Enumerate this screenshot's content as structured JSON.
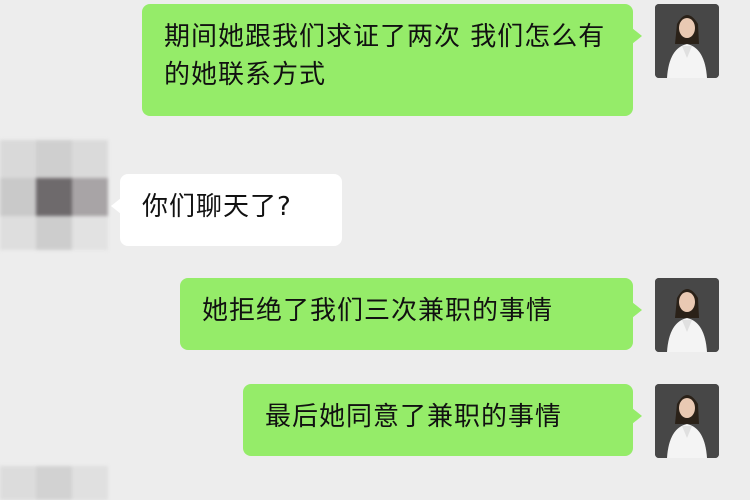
{
  "messages": [
    {
      "side": "sent",
      "text": "期间她跟我们求证了两次 我们怎么有的她联系方式"
    },
    {
      "side": "received",
      "text": "你们聊天了?"
    },
    {
      "side": "sent",
      "text": "她拒绝了我们三次兼职的事情"
    },
    {
      "side": "sent",
      "text": "最后她同意了兼职的事情"
    }
  ],
  "colors": {
    "background": "#ededed",
    "sent_bubble": "#95ec69",
    "received_bubble": "#ffffff"
  }
}
